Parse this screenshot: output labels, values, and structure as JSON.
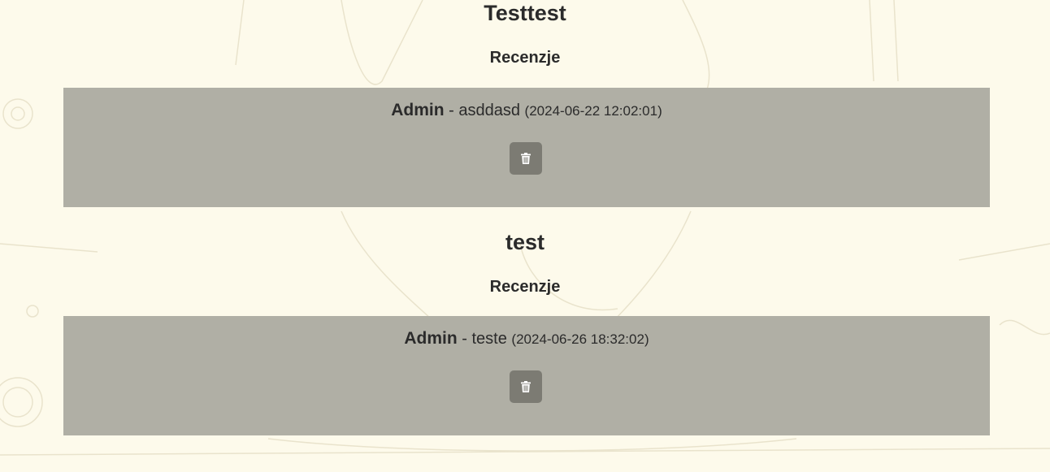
{
  "games": [
    {
      "title": "Testtest",
      "reviews_heading": "Recenzje",
      "review": {
        "author": "Admin",
        "separator": " - ",
        "text": "asddasd",
        "date": "(2024-06-22 12:02:01)",
        "delete_icon": "trash-icon"
      }
    },
    {
      "title": "test",
      "reviews_heading": "Recenzje",
      "review": {
        "author": "Admin",
        "separator": " - ",
        "text": "teste",
        "date": "(2024-06-26 18:32:02)",
        "delete_icon": "trash-icon"
      }
    }
  ],
  "colors": {
    "page_background": "#fdfaeb",
    "card_background": "#b0afa5",
    "delete_button": "#7c7b73",
    "text": "#2b2b2b"
  }
}
